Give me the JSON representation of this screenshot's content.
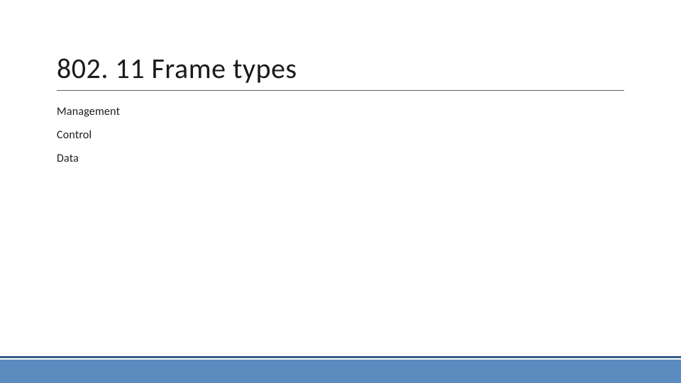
{
  "title": "802. 11 Frame types",
  "items": [
    "Management",
    "Control",
    "Data"
  ]
}
